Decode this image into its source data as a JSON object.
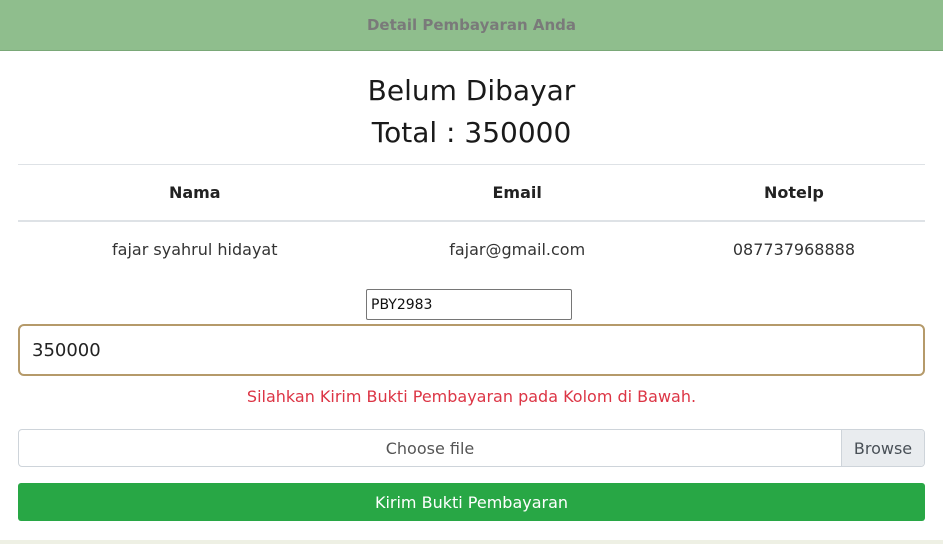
{
  "header": {
    "title": "Detail Pembayaran Anda"
  },
  "status": {
    "text": "Belum Dibayar"
  },
  "total": {
    "label": "Total : ",
    "amount": "350000"
  },
  "table": {
    "headers": [
      "Nama",
      "Email",
      "Notelp"
    ],
    "row": [
      "fajar syahrul hidayat",
      "fajar@gmail.com",
      "087737968888"
    ]
  },
  "form": {
    "payment_code": "PBY2983",
    "amount": "350000",
    "notice": "Silahkan Kirim Bukti Pembayaran pada Kolom di Bawah.",
    "file_placeholder": "Choose file",
    "browse_label": "Browse",
    "submit_label": "Kirim Bukti Pembayaran"
  },
  "colors": {
    "header_bg": "#8fbe8d",
    "notice": "#dc3545",
    "submit_bg": "#28a745"
  }
}
